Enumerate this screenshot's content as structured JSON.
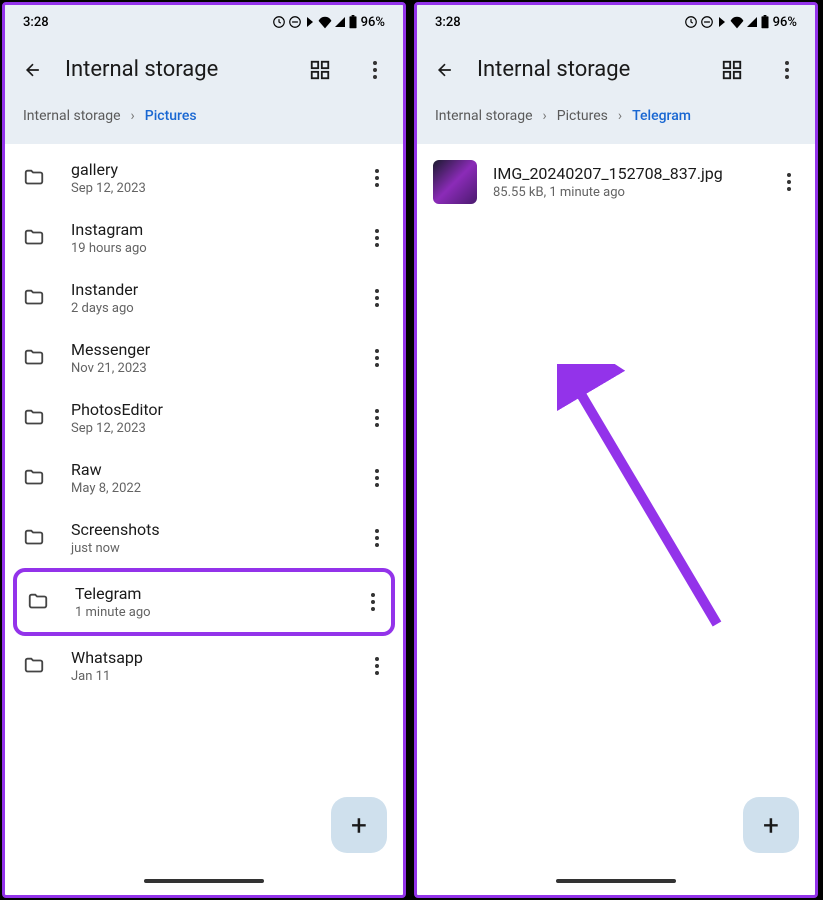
{
  "status": {
    "time": "3:28",
    "battery": "96%"
  },
  "header": {
    "title": "Internal storage"
  },
  "left": {
    "breadcrumb": {
      "root": "Internal storage",
      "current": "Pictures"
    },
    "items": [
      {
        "name": "gallery",
        "meta": "Sep 12, 2023",
        "highlighted": false
      },
      {
        "name": "Instagram",
        "meta": "19 hours ago",
        "highlighted": false
      },
      {
        "name": "Instander",
        "meta": "2 days ago",
        "highlighted": false
      },
      {
        "name": "Messenger",
        "meta": "Nov 21, 2023",
        "highlighted": false
      },
      {
        "name": "PhotosEditor",
        "meta": "Sep 12, 2023",
        "highlighted": false
      },
      {
        "name": "Raw",
        "meta": "May 8, 2022",
        "highlighted": false
      },
      {
        "name": "Screenshots",
        "meta": "just now",
        "highlighted": false
      },
      {
        "name": "Telegram",
        "meta": "1 minute ago",
        "highlighted": true
      },
      {
        "name": "Whatsapp",
        "meta": "Jan 11",
        "highlighted": false
      }
    ]
  },
  "right": {
    "breadcrumb": {
      "root": "Internal storage",
      "mid": "Pictures",
      "current": "Telegram"
    },
    "file": {
      "name": "IMG_20240207_152708_837.jpg",
      "meta": "85.55 kB, 1 minute ago"
    }
  }
}
